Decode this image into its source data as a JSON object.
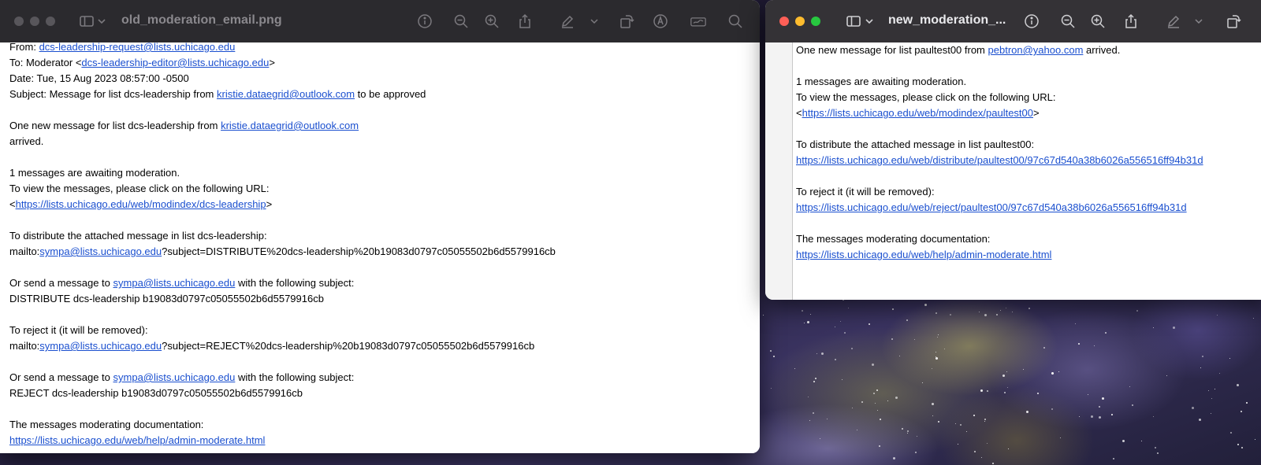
{
  "old_window": {
    "title": "old_moderation_email.png",
    "email": {
      "from_label": "From: ",
      "from_address": "dcs-leadership-request@lists.uchicago.edu",
      "to_label": "To: Moderator <",
      "to_address": "dcs-leadership-editor@lists.uchicago.edu",
      "to_close": ">",
      "date_line": "Date: Tue, 15 Aug 2023 08:57:00 -0500",
      "subject_prefix": "Subject: Message for list dcs-leadership from ",
      "subject_address": "kristie.dataegrid@outlook.com",
      "subject_suffix": " to be approved",
      "intro_prefix": "One new message for list dcs-leadership from ",
      "intro_address": "kristie.dataegrid@outlook.com",
      "intro_line2": "arrived.",
      "awaiting": "1 messages are awaiting moderation.",
      "view_text": "To view the messages, please click on the following URL:",
      "view_open": "<",
      "view_url": "https://lists.uchicago.edu/web/modindex/dcs-leadership",
      "view_close": ">",
      "distribute_text": "To distribute the attached message in list dcs-leadership:",
      "mailto_prefix": "mailto:",
      "sympa_address": "sympa@lists.uchicago.edu",
      "distribute_query": "?subject=DISTRIBUTE%20dcs-leadership%20b19083d0797c05055502b6d5579916cb",
      "or_send_prefix": "Or send a message to ",
      "or_send_suffix": " with the following subject:",
      "distribute_subject": "DISTRIBUTE dcs-leadership b19083d0797c05055502b6d5579916cb",
      "reject_text": "To reject it (it will be removed):",
      "reject_query": "?subject=REJECT%20dcs-leadership%20b19083d0797c05055502b6d5579916cb",
      "reject_subject": "REJECT dcs-leadership b19083d0797c05055502b6d5579916cb",
      "docs_text": "The messages moderating documentation:",
      "docs_url": "https://lists.uchicago.edu/web/help/admin-moderate.html"
    }
  },
  "new_window": {
    "title": "new_moderation_...",
    "email": {
      "intro_prefix": "One new message for list paultest00 from ",
      "intro_address": "pebtron@yahoo.com",
      "intro_suffix": " arrived.",
      "awaiting": "1 messages are awaiting moderation.",
      "view_text": "To view the messages, please click on the following URL:",
      "view_open": "<",
      "view_url": "https://lists.uchicago.edu/web/modindex/paultest00",
      "view_close": ">",
      "distribute_text": "To distribute the attached message in list paultest00:",
      "distribute_url": "https://lists.uchicago.edu/web/distribute/paultest00/97c67d540a38b6026a556516ff94b31d",
      "reject_text": "To reject it (it will be removed):",
      "reject_url": "https://lists.uchicago.edu/web/reject/paultest00/97c67d540a38b6026a556516ff94b31d",
      "docs_text": "The messages moderating documentation:",
      "docs_url": "https://lists.uchicago.edu/web/help/admin-moderate.html"
    }
  },
  "toolbar_icons": [
    "sidebar-icon",
    "chevron-down-icon",
    "info-icon",
    "zoom-out-icon",
    "zoom-in-icon",
    "share-icon",
    "markup-pen-icon",
    "rotate-icon",
    "annotate-icon",
    "signature-icon",
    "search-icon"
  ]
}
